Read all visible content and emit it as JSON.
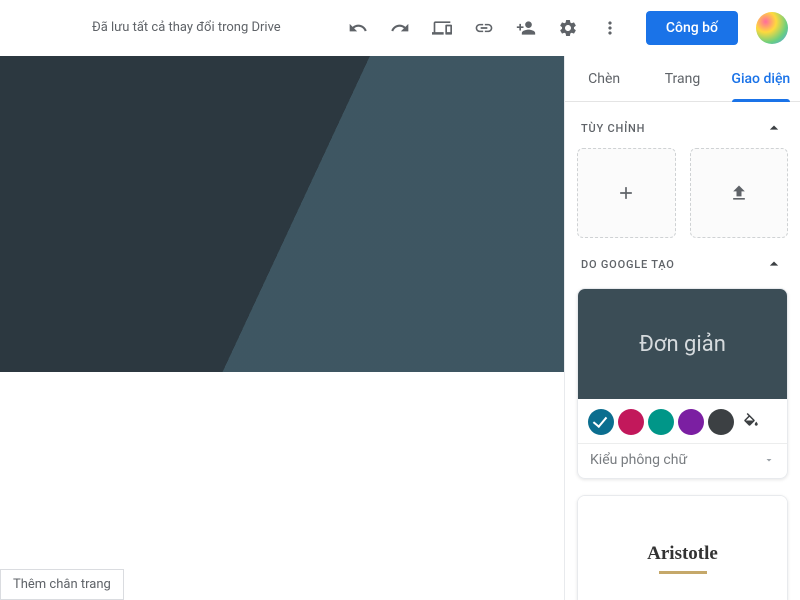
{
  "toolbar": {
    "save_status": "Đã lưu tất cả thay đổi trong Drive",
    "publish_label": "Công bố"
  },
  "footer": {
    "add_footer": "Thêm chân trang"
  },
  "panel": {
    "tabs": {
      "insert": "Chèn",
      "pages": "Trang",
      "themes": "Giao diện"
    },
    "custom_label": "TÙY CHỈNH",
    "google_label": "DO GOOGLE TẠO",
    "theme_simple": {
      "name": "Đơn giản",
      "font_style_label": "Kiểu phông chữ",
      "colors": [
        "#0b6e8f",
        "#c2185b",
        "#009688",
        "#7b1fa2",
        "#3c4043"
      ]
    },
    "theme_aristotle": {
      "name": "Aristotle"
    }
  }
}
